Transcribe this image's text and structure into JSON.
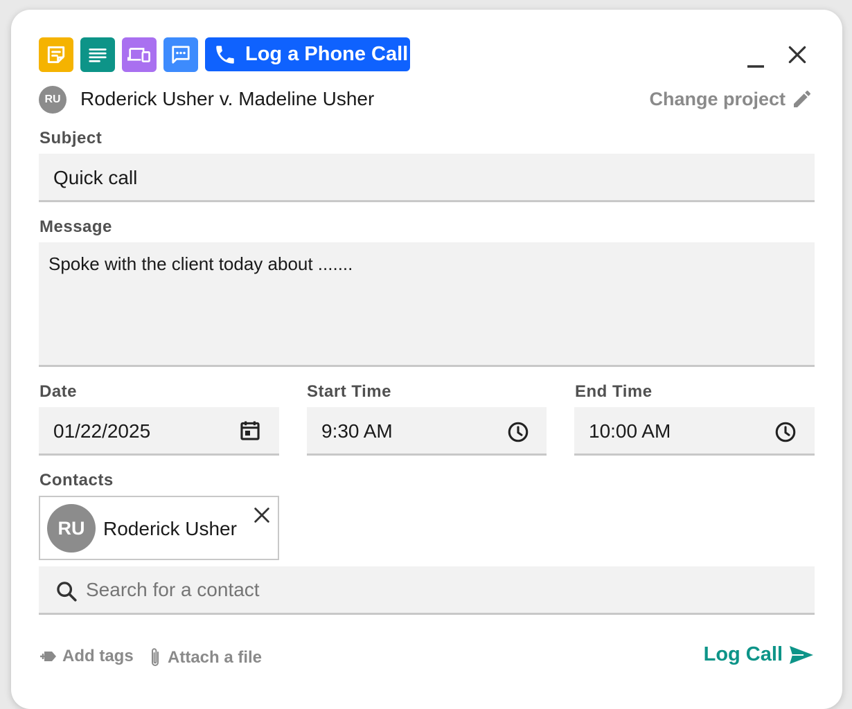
{
  "tabs": {
    "note_icon": "sticky-note-icon",
    "text_icon": "text-lines-icon",
    "devices_icon": "devices-icon",
    "chat_icon": "chat-bubble-icon",
    "active_label": "Log a Phone Call",
    "colors": {
      "note": "#f5b301",
      "text": "#0d9488",
      "devices": "#a970f0",
      "chat": "#3d8bfd",
      "active": "#0f62fe"
    }
  },
  "project": {
    "initials": "RU",
    "name": "Roderick Usher v. Madeline Usher",
    "change_label": "Change project"
  },
  "subject": {
    "label": "Subject",
    "value": "Quick call"
  },
  "message": {
    "label": "Message",
    "value": "Spoke with the client today about ......."
  },
  "date": {
    "label": "Date",
    "value": "01/22/2025"
  },
  "start_time": {
    "label": "Start Time",
    "value": "9:30 AM"
  },
  "end_time": {
    "label": "End Time",
    "value": "10:00 AM"
  },
  "contacts": {
    "label": "Contacts",
    "items": [
      {
        "initials": "RU",
        "name": "Roderick Usher"
      }
    ],
    "search_placeholder": "Search for a contact"
  },
  "footer": {
    "add_tags": "Add tags",
    "attach_file": "Attach a file",
    "submit": "Log Call",
    "accent_color": "#0d9488"
  }
}
